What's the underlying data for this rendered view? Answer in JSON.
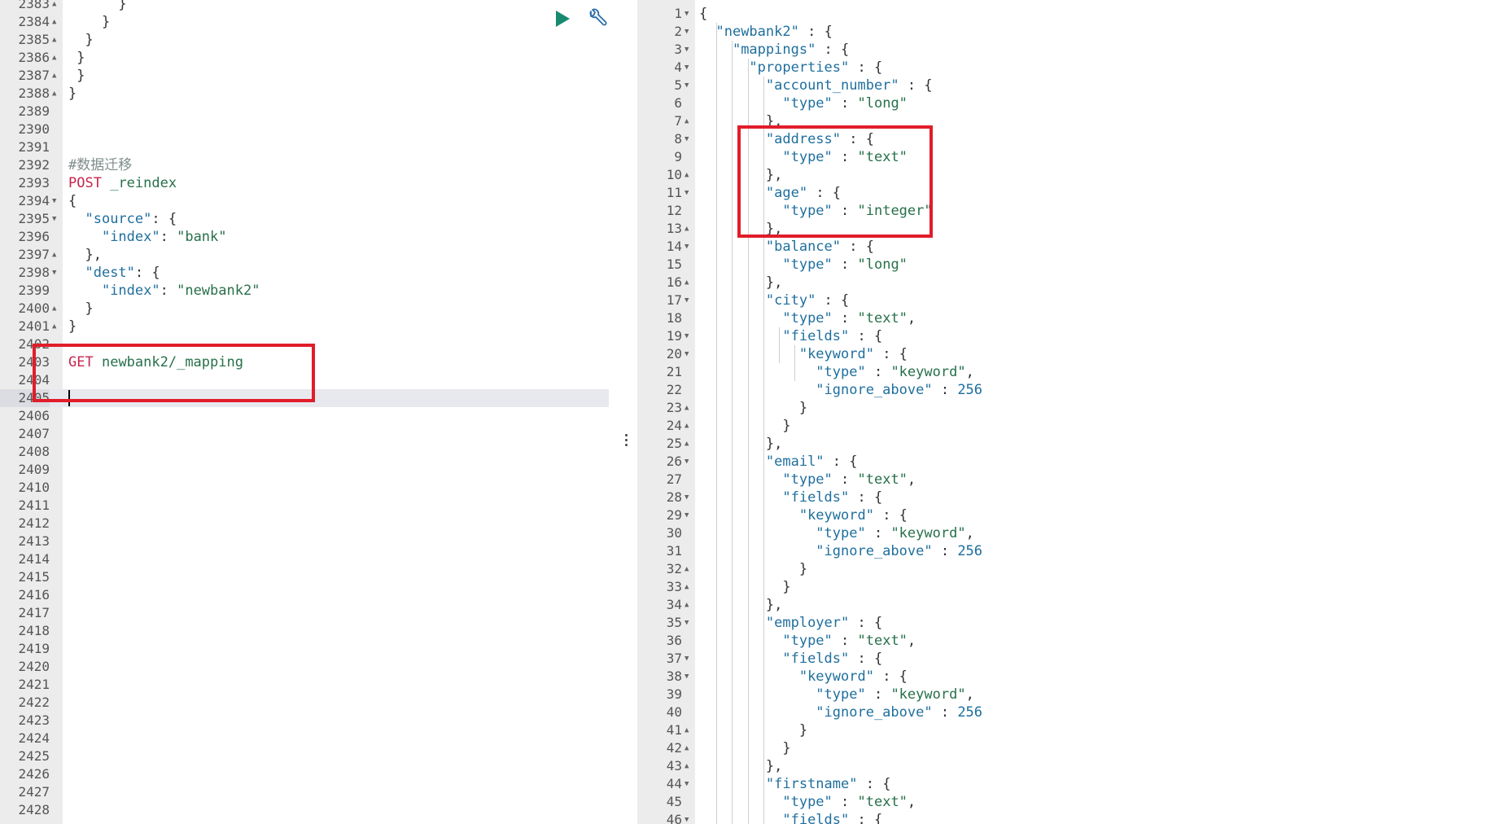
{
  "request_editor": {
    "lines": [
      {
        "n": "2383",
        "fold": "▲",
        "text": "      }"
      },
      {
        "n": "2384",
        "fold": "▲",
        "text": "    }"
      },
      {
        "n": "2385",
        "fold": "▲",
        "text": "  }"
      },
      {
        "n": "2386",
        "fold": "▲",
        "text": " }"
      },
      {
        "n": "2387",
        "fold": "▲",
        "text": " }"
      },
      {
        "n": "2388",
        "fold": "▲",
        "text": "}"
      },
      {
        "n": "2389",
        "fold": "",
        "text": ""
      },
      {
        "n": "2390",
        "fold": "",
        "text": ""
      },
      {
        "n": "2391",
        "fold": "",
        "text": ""
      },
      {
        "n": "2392",
        "fold": "",
        "text": "#数据迁移"
      },
      {
        "n": "2393",
        "fold": "",
        "text": "POST _reindex"
      },
      {
        "n": "2394",
        "fold": "▼",
        "text": "{"
      },
      {
        "n": "2395",
        "fold": "▼",
        "text": "  \"source\": {"
      },
      {
        "n": "2396",
        "fold": "",
        "text": "    \"index\": \"bank\""
      },
      {
        "n": "2397",
        "fold": "▲",
        "text": "  },"
      },
      {
        "n": "2398",
        "fold": "▼",
        "text": "  \"dest\": {"
      },
      {
        "n": "2399",
        "fold": "",
        "text": "    \"index\": \"newbank2\""
      },
      {
        "n": "2400",
        "fold": "▲",
        "text": "  }"
      },
      {
        "n": "2401",
        "fold": "▲",
        "text": "}"
      },
      {
        "n": "2402",
        "fold": "",
        "text": ""
      },
      {
        "n": "2403",
        "fold": "",
        "text": "GET newbank2/_mapping"
      },
      {
        "n": "2404",
        "fold": "",
        "text": ""
      },
      {
        "n": "2405",
        "fold": "",
        "text": ""
      },
      {
        "n": "2406",
        "fold": "",
        "text": ""
      },
      {
        "n": "2407",
        "fold": "",
        "text": ""
      },
      {
        "n": "2408",
        "fold": "",
        "text": ""
      },
      {
        "n": "2409",
        "fold": "",
        "text": ""
      },
      {
        "n": "2410",
        "fold": "",
        "text": ""
      },
      {
        "n": "2411",
        "fold": "",
        "text": ""
      },
      {
        "n": "2412",
        "fold": "",
        "text": ""
      },
      {
        "n": "2413",
        "fold": "",
        "text": ""
      },
      {
        "n": "2414",
        "fold": "",
        "text": ""
      },
      {
        "n": "2415",
        "fold": "",
        "text": ""
      },
      {
        "n": "2416",
        "fold": "",
        "text": ""
      },
      {
        "n": "2417",
        "fold": "",
        "text": ""
      },
      {
        "n": "2418",
        "fold": "",
        "text": ""
      },
      {
        "n": "2419",
        "fold": "",
        "text": ""
      },
      {
        "n": "2420",
        "fold": "",
        "text": ""
      },
      {
        "n": "2421",
        "fold": "",
        "text": ""
      },
      {
        "n": "2422",
        "fold": "",
        "text": ""
      },
      {
        "n": "2423",
        "fold": "",
        "text": ""
      },
      {
        "n": "2424",
        "fold": "",
        "text": ""
      },
      {
        "n": "2425",
        "fold": "",
        "text": ""
      },
      {
        "n": "2426",
        "fold": "",
        "text": ""
      },
      {
        "n": "2427",
        "fold": "",
        "text": ""
      },
      {
        "n": "2428",
        "fold": "",
        "text": ""
      }
    ],
    "active_line": "2405"
  },
  "toolbar": {
    "run_icon": "play-icon",
    "settings_icon": "wrench-icon"
  },
  "response_viewer": {
    "lines": [
      {
        "n": "1",
        "fold": "▼",
        "text": "{"
      },
      {
        "n": "2",
        "fold": "▼",
        "text": "  \"newbank2\" : {"
      },
      {
        "n": "3",
        "fold": "▼",
        "text": "    \"mappings\" : {"
      },
      {
        "n": "4",
        "fold": "▼",
        "text": "      \"properties\" : {"
      },
      {
        "n": "5",
        "fold": "▼",
        "text": "        \"account_number\" : {"
      },
      {
        "n": "6",
        "fold": "",
        "text": "          \"type\" : \"long\""
      },
      {
        "n": "7",
        "fold": "▲",
        "text": "        },"
      },
      {
        "n": "8",
        "fold": "▼",
        "text": "        \"address\" : {"
      },
      {
        "n": "9",
        "fold": "",
        "text": "          \"type\" : \"text\""
      },
      {
        "n": "10",
        "fold": "▲",
        "text": "        },"
      },
      {
        "n": "11",
        "fold": "▼",
        "text": "        \"age\" : {"
      },
      {
        "n": "12",
        "fold": "",
        "text": "          \"type\" : \"integer\""
      },
      {
        "n": "13",
        "fold": "▲",
        "text": "        },"
      },
      {
        "n": "14",
        "fold": "▼",
        "text": "        \"balance\" : {"
      },
      {
        "n": "15",
        "fold": "",
        "text": "          \"type\" : \"long\""
      },
      {
        "n": "16",
        "fold": "▲",
        "text": "        },"
      },
      {
        "n": "17",
        "fold": "▼",
        "text": "        \"city\" : {"
      },
      {
        "n": "18",
        "fold": "",
        "text": "          \"type\" : \"text\","
      },
      {
        "n": "19",
        "fold": "▼",
        "text": "          \"fields\" : {"
      },
      {
        "n": "20",
        "fold": "▼",
        "text": "            \"keyword\" : {"
      },
      {
        "n": "21",
        "fold": "",
        "text": "              \"type\" : \"keyword\","
      },
      {
        "n": "22",
        "fold": "",
        "text": "              \"ignore_above\" : 256"
      },
      {
        "n": "23",
        "fold": "▲",
        "text": "            }"
      },
      {
        "n": "24",
        "fold": "▲",
        "text": "          }"
      },
      {
        "n": "25",
        "fold": "▲",
        "text": "        },"
      },
      {
        "n": "26",
        "fold": "▼",
        "text": "        \"email\" : {"
      },
      {
        "n": "27",
        "fold": "",
        "text": "          \"type\" : \"text\","
      },
      {
        "n": "28",
        "fold": "▼",
        "text": "          \"fields\" : {"
      },
      {
        "n": "29",
        "fold": "▼",
        "text": "            \"keyword\" : {"
      },
      {
        "n": "30",
        "fold": "",
        "text": "              \"type\" : \"keyword\","
      },
      {
        "n": "31",
        "fold": "",
        "text": "              \"ignore_above\" : 256"
      },
      {
        "n": "32",
        "fold": "▲",
        "text": "            }"
      },
      {
        "n": "33",
        "fold": "▲",
        "text": "          }"
      },
      {
        "n": "34",
        "fold": "▲",
        "text": "        },"
      },
      {
        "n": "35",
        "fold": "▼",
        "text": "        \"employer\" : {"
      },
      {
        "n": "36",
        "fold": "",
        "text": "          \"type\" : \"text\","
      },
      {
        "n": "37",
        "fold": "▼",
        "text": "          \"fields\" : {"
      },
      {
        "n": "38",
        "fold": "▼",
        "text": "            \"keyword\" : {"
      },
      {
        "n": "39",
        "fold": "",
        "text": "              \"type\" : \"keyword\","
      },
      {
        "n": "40",
        "fold": "",
        "text": "              \"ignore_above\" : 256"
      },
      {
        "n": "41",
        "fold": "▲",
        "text": "            }"
      },
      {
        "n": "42",
        "fold": "▲",
        "text": "          }"
      },
      {
        "n": "43",
        "fold": "▲",
        "text": "        },"
      },
      {
        "n": "44",
        "fold": "▼",
        "text": "        \"firstname\" : {"
      },
      {
        "n": "45",
        "fold": "",
        "text": "          \"type\" : \"text\","
      },
      {
        "n": "46",
        "fold": "▼",
        "text": "          \"fields\" : {"
      }
    ]
  },
  "colors": {
    "highlight_box": "#e11d2a",
    "gutter": "#ececec",
    "active_line": "#e8e9ee",
    "run_button": "#178a6f",
    "wrench": "#2a6ea8"
  }
}
